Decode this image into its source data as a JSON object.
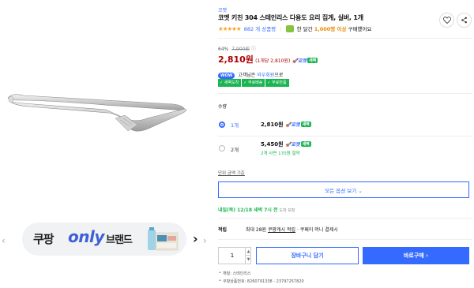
{
  "gallery": {
    "prev_arrow": "‹",
    "next_arrow": "›",
    "brand_banner": {
      "text_coupang": "쿠팡",
      "text_only": "only",
      "text_brand": "브랜드",
      "chevron": "›"
    }
  },
  "product": {
    "brand": "코멧",
    "title": "코멧 키친 304 스테인리스 다용도 요리 집게, 실버, 1개",
    "rating_stars": "★★★★★",
    "review_count": "882 개 상품평",
    "buy_text_prefix": "한 달간",
    "buy_text_highlight": "1,000명 이상",
    "buy_text_suffix": "구매했어요",
    "discount_rate": "64%",
    "original_price": "7,900원",
    "info_icon": "ⓘ",
    "price": "2,810원",
    "unit_price": "(1개당 2,810원)",
    "rocket_label": "로켓",
    "rocket_badge": "새벽"
  },
  "wow": {
    "badge": "WOW",
    "text_prefix": "고객님은",
    "member_type": "와우회원",
    "text_suffix": "으로",
    "benefits": [
      "✓ 새벽도착",
      "✓ 무료배송",
      "✓ 무료반품"
    ]
  },
  "quantity_section": {
    "label": "수량",
    "options": [
      {
        "name": "1개",
        "price": "2,810원",
        "rocket": "로켓",
        "badge": "새벽",
        "saving": ""
      },
      {
        "name": "2개",
        "price": "5,450원",
        "rocket": "로켓",
        "badge": "새벽",
        "saving": "2개 사면 170원 절약"
      }
    ],
    "unit_price_link": "단위 금액 기준",
    "all_options_button": "모든 옵션 보기 ⌄"
  },
  "delivery": {
    "arrival_main": "내일(목) 12/18 새벽 7시 전",
    "arrival_note": "도착 보장"
  },
  "cashback": {
    "label": "적립",
    "max_text": "최대 28원",
    "link": "쿠팡캐시 적립",
    "tail": "· 쿠페이 머니 결제시"
  },
  "purchase": {
    "quantity": "1",
    "up": "▲",
    "down": "▼",
    "cart_button": "장바구니 담기",
    "buy_button": "바로구매 ›"
  },
  "specs": [
    "재질: 스테인리스",
    "쿠팡상품번호: 8260791338 - 23797257820"
  ],
  "colors": {
    "accent": "#346aff",
    "price": "#ae0000",
    "green": "#1ab550",
    "star": "#f5a623"
  }
}
